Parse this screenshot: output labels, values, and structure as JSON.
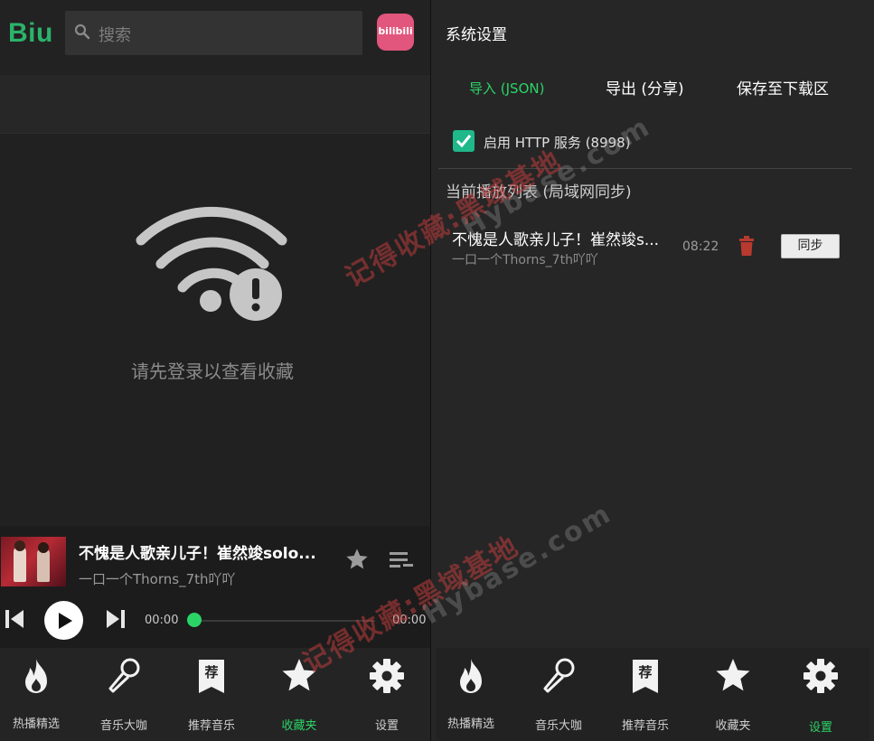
{
  "left": {
    "logo": "Biu",
    "search_placeholder": "搜索",
    "bili_badge": "bilibili",
    "login_message": "请先登录以查看收藏",
    "player": {
      "title": "不愧是人歌亲儿子！崔然竣solo...",
      "artist": "一口一个Thorns_7th吖吖",
      "time_current": "00:00",
      "time_total": "00:00",
      "progress": 0
    },
    "nav": [
      {
        "label": "热播精选",
        "icon": "fire-icon",
        "active": false
      },
      {
        "label": "音乐大咖",
        "icon": "microphone-icon",
        "active": false
      },
      {
        "label": "推荐音乐",
        "icon": "recommend-icon",
        "active": false
      },
      {
        "label": "收藏夹",
        "icon": "star-icon",
        "active": true
      },
      {
        "label": "设置",
        "icon": "gear-icon",
        "active": false
      }
    ],
    "recommend_glyph": "荐"
  },
  "right": {
    "title": "系统设置",
    "actions": {
      "import": "导入 (JSON)",
      "export": "导出 (分享)",
      "save": "保存至下载区"
    },
    "http_service": {
      "label": "启用 HTTP 服务 (8998)",
      "checked": true
    },
    "playlist_header": "当前播放列表 (局域网同步)",
    "playlist": [
      {
        "title": "不愧是人歌亲儿子！崔然竣s...",
        "artist": "一口一个Thorns_7th吖吖",
        "duration": "08:22",
        "sync_label": "同步"
      }
    ],
    "nav": [
      {
        "label": "热播精选",
        "icon": "fire-icon",
        "active": false
      },
      {
        "label": "音乐大咖",
        "icon": "microphone-icon",
        "active": false
      },
      {
        "label": "推荐音乐",
        "icon": "recommend-icon",
        "active": false
      },
      {
        "label": "收藏夹",
        "icon": "star-icon",
        "active": false
      },
      {
        "label": "设置",
        "icon": "gear-icon",
        "active": true
      }
    ]
  },
  "colors": {
    "accent": "#2bd466",
    "logo": "#2bb36a",
    "checkbox": "#1fb88a",
    "trash": "#b83a2f",
    "watermark": "#be3c3c"
  },
  "watermarks": [
    "记得收藏:黑域基地",
    "Hybase.com"
  ]
}
